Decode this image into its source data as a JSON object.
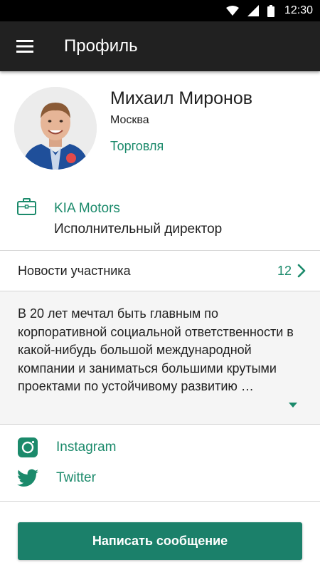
{
  "status_bar": {
    "time": "12:30"
  },
  "app_bar": {
    "title": "Профиль",
    "menu_icon": "hamburger-menu-icon"
  },
  "profile": {
    "name": "Михаил Миронов",
    "city": "Москва",
    "industry": "Торговля"
  },
  "job": {
    "icon": "briefcase-icon",
    "company": "KIA Motors",
    "position": "Исполнительный директор"
  },
  "news": {
    "label": "Новости участника",
    "count": "12"
  },
  "bio": {
    "text": "В 20 лет мечтал быть главным по корпоративной социальной ответственности в какой-нибудь большой международной компании и заниматься большими крутыми проектами по устойчивому развитию …"
  },
  "social": [
    {
      "label": "Instagram",
      "icon": "instagram-icon"
    },
    {
      "label": "Twitter",
      "icon": "twitter-icon"
    }
  ],
  "actions": {
    "write_message": "Написать сообщение"
  },
  "colors": {
    "accent": "#1b8a6b",
    "button": "#1b806a",
    "app_bar": "#212121",
    "status_bar": "#000000",
    "bio_background": "#f5f5f5"
  }
}
